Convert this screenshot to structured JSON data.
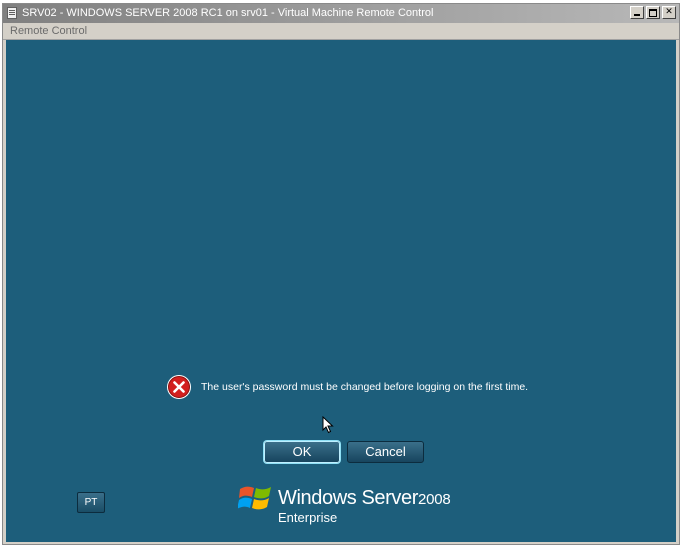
{
  "window": {
    "title": "SRV02 - WINDOWS SERVER 2008 RC1 on srv01 - Virtual Machine Remote Control",
    "minimize_label": "",
    "restore_label": "",
    "close_label": "✕"
  },
  "menubar": {
    "items": [
      {
        "label": "Remote Control"
      }
    ]
  },
  "dialog": {
    "message": "The user's password must be changed before logging on the first time.",
    "icon": "error-icon",
    "ok_label": "OK",
    "cancel_label": "Cancel"
  },
  "footer": {
    "pt_label": "PT",
    "brand": "Windows Server",
    "version": "2008",
    "edition": "Enterprise"
  },
  "colors": {
    "desktop": "#1d5e7b",
    "error_red": "#d21f1f",
    "titlebar": "#808080"
  }
}
